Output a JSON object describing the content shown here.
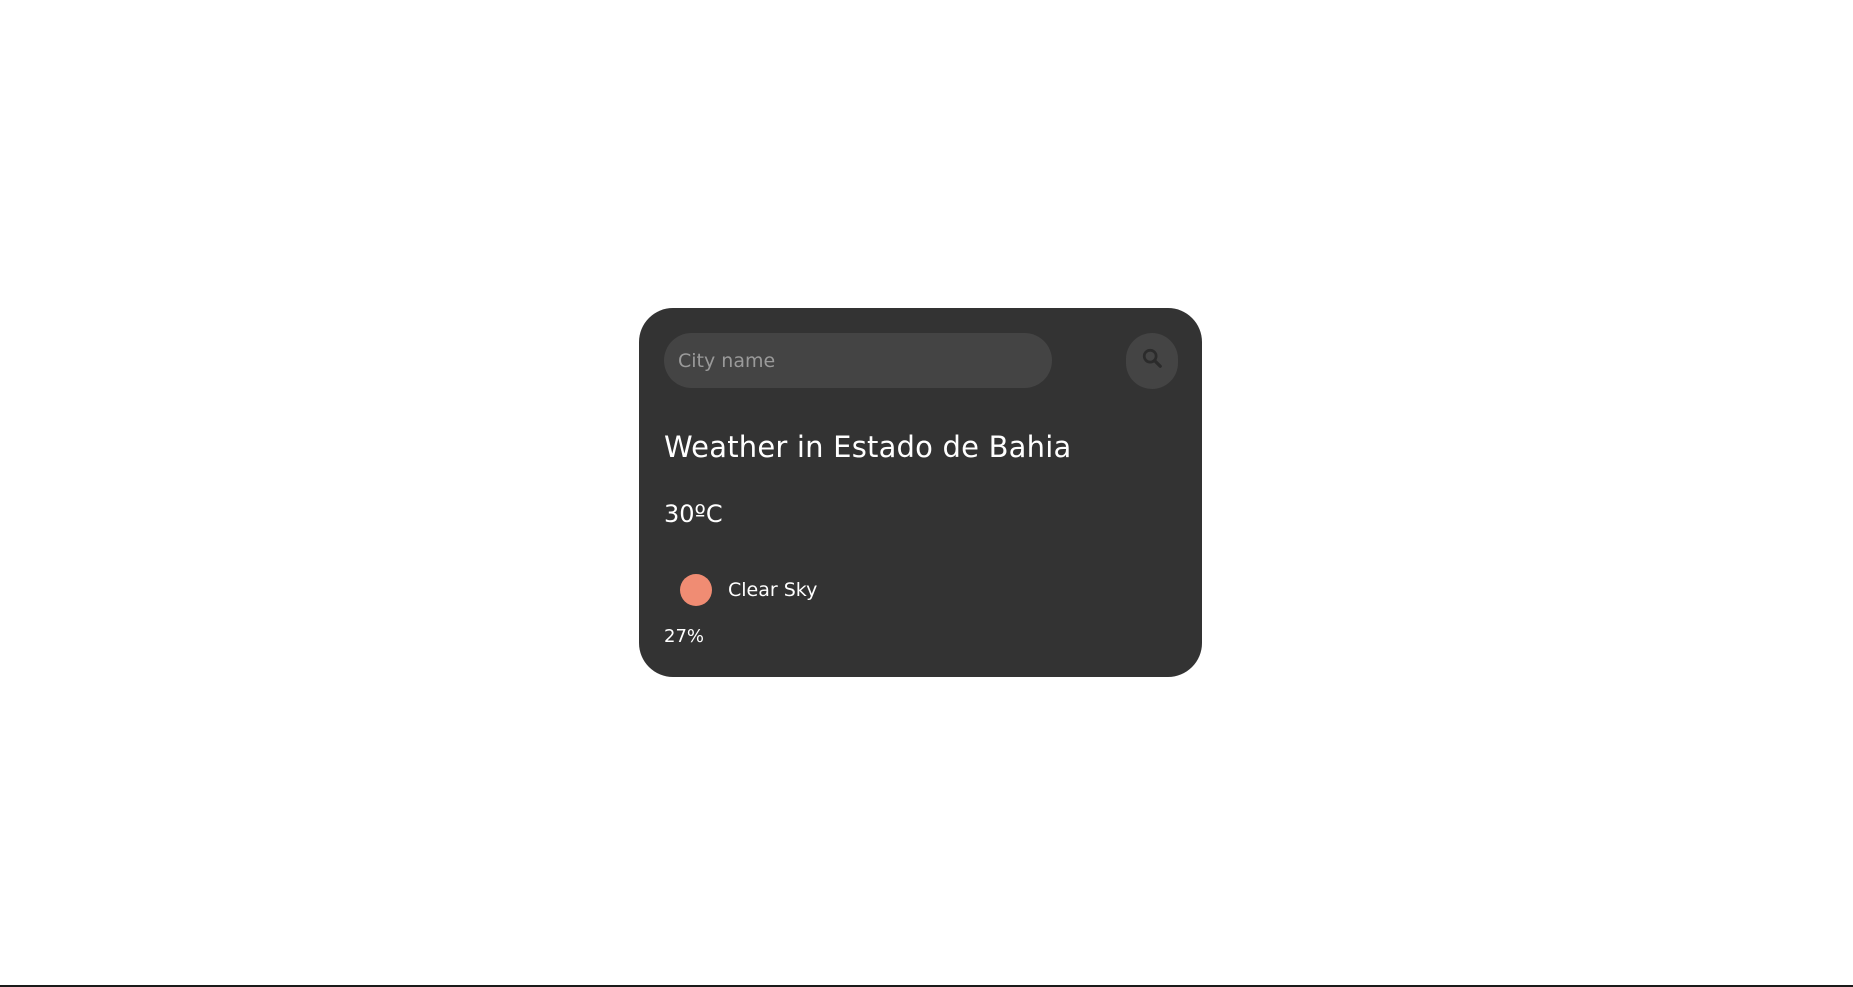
{
  "search": {
    "placeholder": "City name",
    "value": "",
    "button_icon": "search-icon"
  },
  "weather": {
    "title": "Weather in Estado de Bahia",
    "temperature": "30ºC",
    "condition": "Clear Sky",
    "condition_icon": "sun-icon",
    "humidity": "27%"
  },
  "colors": {
    "page_background": "#ffffff",
    "card_background": "#333333",
    "input_background": "#444444",
    "text": "#ffffff",
    "placeholder_text": "#9a9a9a",
    "condition_icon": "#f08c73"
  }
}
